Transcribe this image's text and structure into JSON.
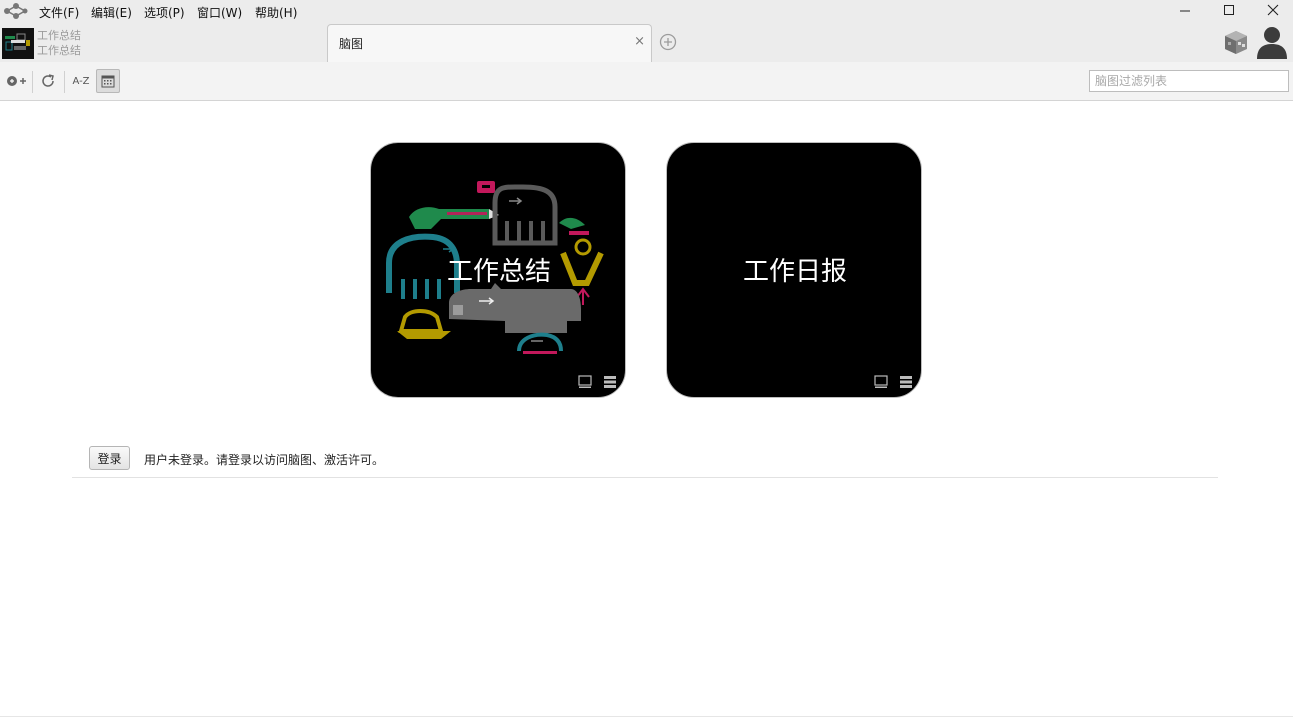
{
  "menu": {
    "items": [
      {
        "label": "文件(F)"
      },
      {
        "label": "编辑(E)"
      },
      {
        "label": "选项(P)"
      },
      {
        "label": "窗口(W)"
      },
      {
        "label": "帮助(H)"
      }
    ]
  },
  "tabs": {
    "inactive": {
      "line1": "工作总结",
      "line2": "工作总结"
    },
    "active": {
      "title": "脑图",
      "close": "×"
    }
  },
  "toolbar": {
    "sort_label": "A-Z",
    "filter_placeholder": "脑图过滤列表"
  },
  "cards": [
    {
      "title": "工作总结"
    },
    {
      "title": "工作日报"
    }
  ],
  "login": {
    "button_label": "登录",
    "message": "用户未登录。请登录以访问脑图、激活许可。"
  },
  "icons": {
    "app_logo": "mindmap-logo-icon",
    "minimize": "minimize-icon",
    "maximize": "maximize-icon",
    "close": "close-icon",
    "add_tab": "plus-circle-icon",
    "cube": "cube-3d-icon",
    "user": "user-avatar-icon",
    "new_map": "add-map-icon",
    "refresh": "refresh-icon",
    "calendar": "calendar-icon",
    "view": "monitor-icon",
    "list": "list-icon"
  },
  "colors": {
    "menubar_bg": "#ececec",
    "toolbar_bg": "#f3f3f3",
    "card_bg": "#000000",
    "accent_pink": "#c2185b",
    "accent_teal": "#1e7f8c",
    "accent_yellow": "#b39a00",
    "accent_green": "#1f8a4c"
  }
}
